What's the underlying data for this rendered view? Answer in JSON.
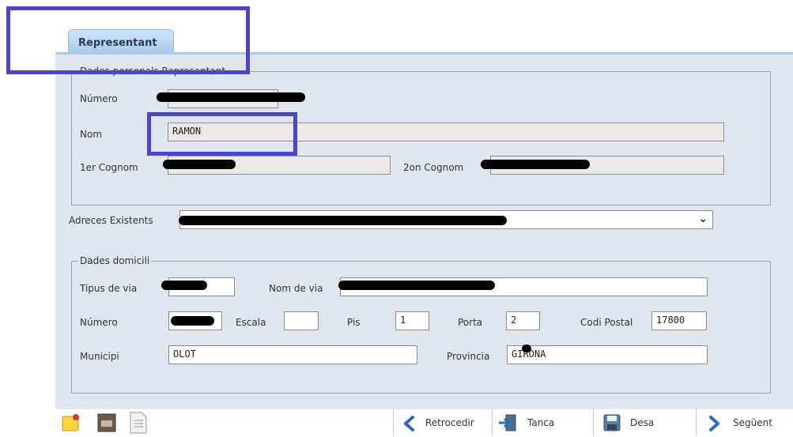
{
  "tab": {
    "label": "Representant"
  },
  "personal": {
    "legend": "Dades personals Representant",
    "numero_label": "Número",
    "nom_label": "Nom",
    "nom_value": "RAMON",
    "cognom1_label": "1er Cognom",
    "cognom2_label": "2on Cognom"
  },
  "adreces": {
    "label": "Adreces Existents"
  },
  "domicili": {
    "legend": "Dades domicili",
    "tipus_via_label": "Tipus de via",
    "nom_via_label": "Nom de via",
    "numero_label": "Número",
    "escala_label": "Escala",
    "pis_label": "Pis",
    "pis_value": "1",
    "porta_label": "Porta",
    "porta_value": "2",
    "codi_postal_label": "Codi Postal",
    "codi_postal_value": "17800",
    "municipi_label": "Municipi",
    "municipi_value": "OLOT",
    "provincia_label": "Provincia",
    "provincia_value": "GIRONA"
  },
  "toolbar": {
    "icons": [
      "new-document-icon",
      "archive-icon",
      "document-icon"
    ],
    "retrocedir": "Retrocedir",
    "tanca": "Tanca",
    "desa": "Desa",
    "seguent": "Següent"
  },
  "colors": {
    "highlight": "#4a45c9",
    "panel_bg": "#dfe6f0",
    "tab_bg": "#a9cbe9"
  }
}
